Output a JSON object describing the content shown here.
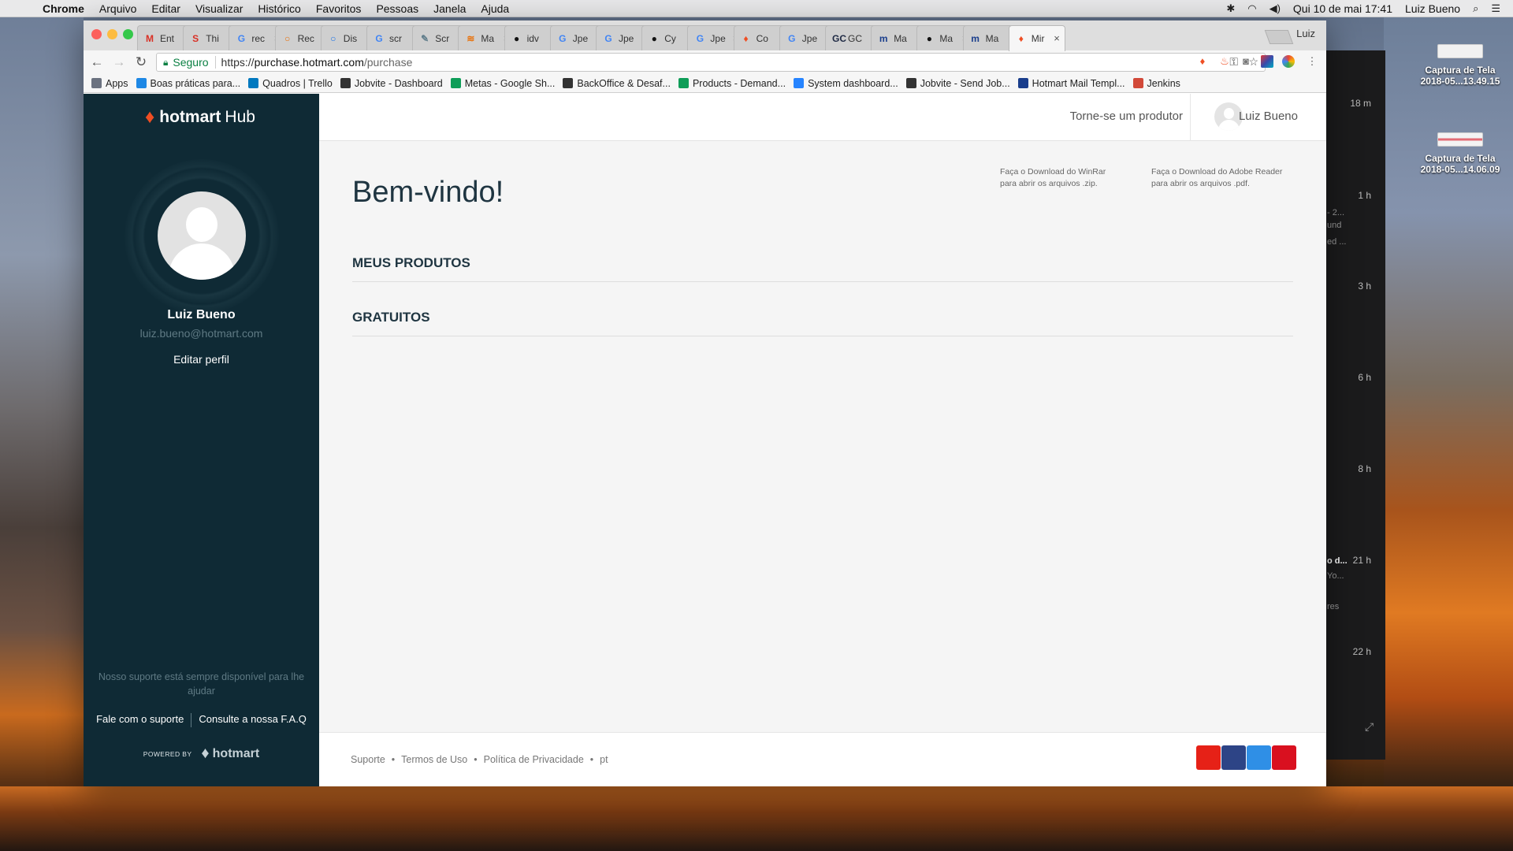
{
  "menubar": {
    "app": "Chrome",
    "items": [
      "Arquivo",
      "Editar",
      "Visualizar",
      "Histórico",
      "Favoritos",
      "Pessoas",
      "Janela",
      "Ajuda"
    ],
    "datetime": "Qui 10 de mai  17:41",
    "user": "Luiz Bueno"
  },
  "tabs": [
    {
      "label": "Ent",
      "icon": "gmail-icon",
      "color": "#d93025",
      "glyph": "M"
    },
    {
      "label": "Thi",
      "icon": "s-icon",
      "color": "#d93025",
      "glyph": "S"
    },
    {
      "label": "rec",
      "icon": "google-icon",
      "color": "#4285f4",
      "glyph": "G"
    },
    {
      "label": "Rec",
      "icon": "circle-icon",
      "color": "#e8710a",
      "glyph": "○"
    },
    {
      "label": "Dis",
      "icon": "circle-icon",
      "color": "#1a73e8",
      "glyph": "○"
    },
    {
      "label": "scr",
      "icon": "google-icon",
      "color": "#4285f4",
      "glyph": "G"
    },
    {
      "label": "Scr",
      "icon": "scribble-icon",
      "color": "#607d8b",
      "glyph": "✎"
    },
    {
      "label": "Ma",
      "icon": "stack-icon",
      "color": "#e8710a",
      "glyph": "≋"
    },
    {
      "label": "idv",
      "icon": "github-icon",
      "color": "#111",
      "glyph": "●"
    },
    {
      "label": "Jpe",
      "icon": "google-icon",
      "color": "#4285f4",
      "glyph": "G"
    },
    {
      "label": "Jpe",
      "icon": "google-icon",
      "color": "#4285f4",
      "glyph": "G"
    },
    {
      "label": "Cy",
      "icon": "github-icon",
      "color": "#111",
      "glyph": "●"
    },
    {
      "label": "Jpe",
      "icon": "google-icon",
      "color": "#4285f4",
      "glyph": "G"
    },
    {
      "label": "Co",
      "icon": "hotmart-icon",
      "color": "#ef4e23",
      "glyph": "♦"
    },
    {
      "label": "Jpe",
      "icon": "google-icon",
      "color": "#4285f4",
      "glyph": "G"
    },
    {
      "label": "GC",
      "icon": "gc-icon",
      "color": "#1f2a44",
      "glyph": "GC"
    },
    {
      "label": "Ma",
      "icon": "mvn-icon",
      "color": "#1a3e8c",
      "glyph": "m"
    },
    {
      "label": "Ma",
      "icon": "github-icon",
      "color": "#111",
      "glyph": "●"
    },
    {
      "label": "Ma",
      "icon": "mvn-icon",
      "color": "#1a3e8c",
      "glyph": "m"
    },
    {
      "label": "Mir",
      "icon": "hotmart-icon",
      "color": "#ef4e23",
      "glyph": "♦",
      "active": true
    }
  ],
  "profile_name": "Luiz",
  "omnibox": {
    "secure_label": "Seguro",
    "url_scheme": "https://",
    "url_host": "purchase.hotmart.com",
    "url_path": "/purchase"
  },
  "bookmarks": [
    {
      "label": "Apps",
      "color": "#6b7280"
    },
    {
      "label": "Boas práticas para...",
      "color": "#1e88e5"
    },
    {
      "label": "Quadros | Trello",
      "color": "#0079bf"
    },
    {
      "label": "Jobvite - Dashboard",
      "color": "#333"
    },
    {
      "label": "Metas - Google Sh...",
      "color": "#0f9d58"
    },
    {
      "label": "BackOffice & Desaf...",
      "color": "#333"
    },
    {
      "label": "Products - Demand...",
      "color": "#0f9d58"
    },
    {
      "label": "System dashboard...",
      "color": "#2684ff"
    },
    {
      "label": "Jobvite - Send Job...",
      "color": "#333"
    },
    {
      "label": "Hotmart Mail Templ...",
      "color": "#1a3e8c"
    },
    {
      "label": "Jenkins",
      "color": "#d24939"
    }
  ],
  "sidebar": {
    "brand_bold": "hotmart",
    "brand_light": "Hub",
    "user_name": "Luiz Bueno",
    "user_email": "luiz.bueno@hotmart.com",
    "edit_profile": "Editar perfil",
    "support_text": "Nosso suporte está sempre disponível para lhe ajudar",
    "support_link": "Fale com o suporte",
    "faq_link": "Consulte a nossa F.A.Q",
    "powered_by": "POWERED BY",
    "powered_brand": "hotmart"
  },
  "header": {
    "become_producer": "Torne-se um produtor",
    "user_name": "Luiz Bueno"
  },
  "main": {
    "welcome": "Bem-vindo!",
    "download_winrar_1": "Faça o Download do WinRar",
    "download_winrar_2": "para abrir os arquivos .zip.",
    "download_reader_1": "Faça o Download do Adobe Reader",
    "download_reader_2": "para abrir os arquivos .pdf.",
    "my_products": "MEUS PRODUTOS",
    "free": "GRATUITOS"
  },
  "footer": {
    "support": "Suporte",
    "terms": "Termos de Uso",
    "privacy": "Política de Privacidade",
    "lang": "pt",
    "social": [
      {
        "icon": "youtube-icon",
        "color": "#e62117"
      },
      {
        "icon": "facebook-icon",
        "color": "#2d4486"
      },
      {
        "icon": "twitter-icon",
        "color": "#2f8fe6"
      },
      {
        "icon": "pinterest-icon",
        "color": "#d9101f"
      }
    ]
  },
  "background_window": {
    "times": [
      "18 m",
      "1 h",
      "3 h",
      "6 h",
      "8 h",
      "21 h",
      "22 h"
    ],
    "fragments": [
      "- 2...",
      "und",
      "ed ...",
      "o d...",
      "Yo...",
      "res"
    ]
  },
  "desktop_icons": [
    {
      "label": "Captura de Tela 2018-05...13.49.15"
    },
    {
      "label": "Captura de Tela 2018-05...14.06.09"
    }
  ]
}
